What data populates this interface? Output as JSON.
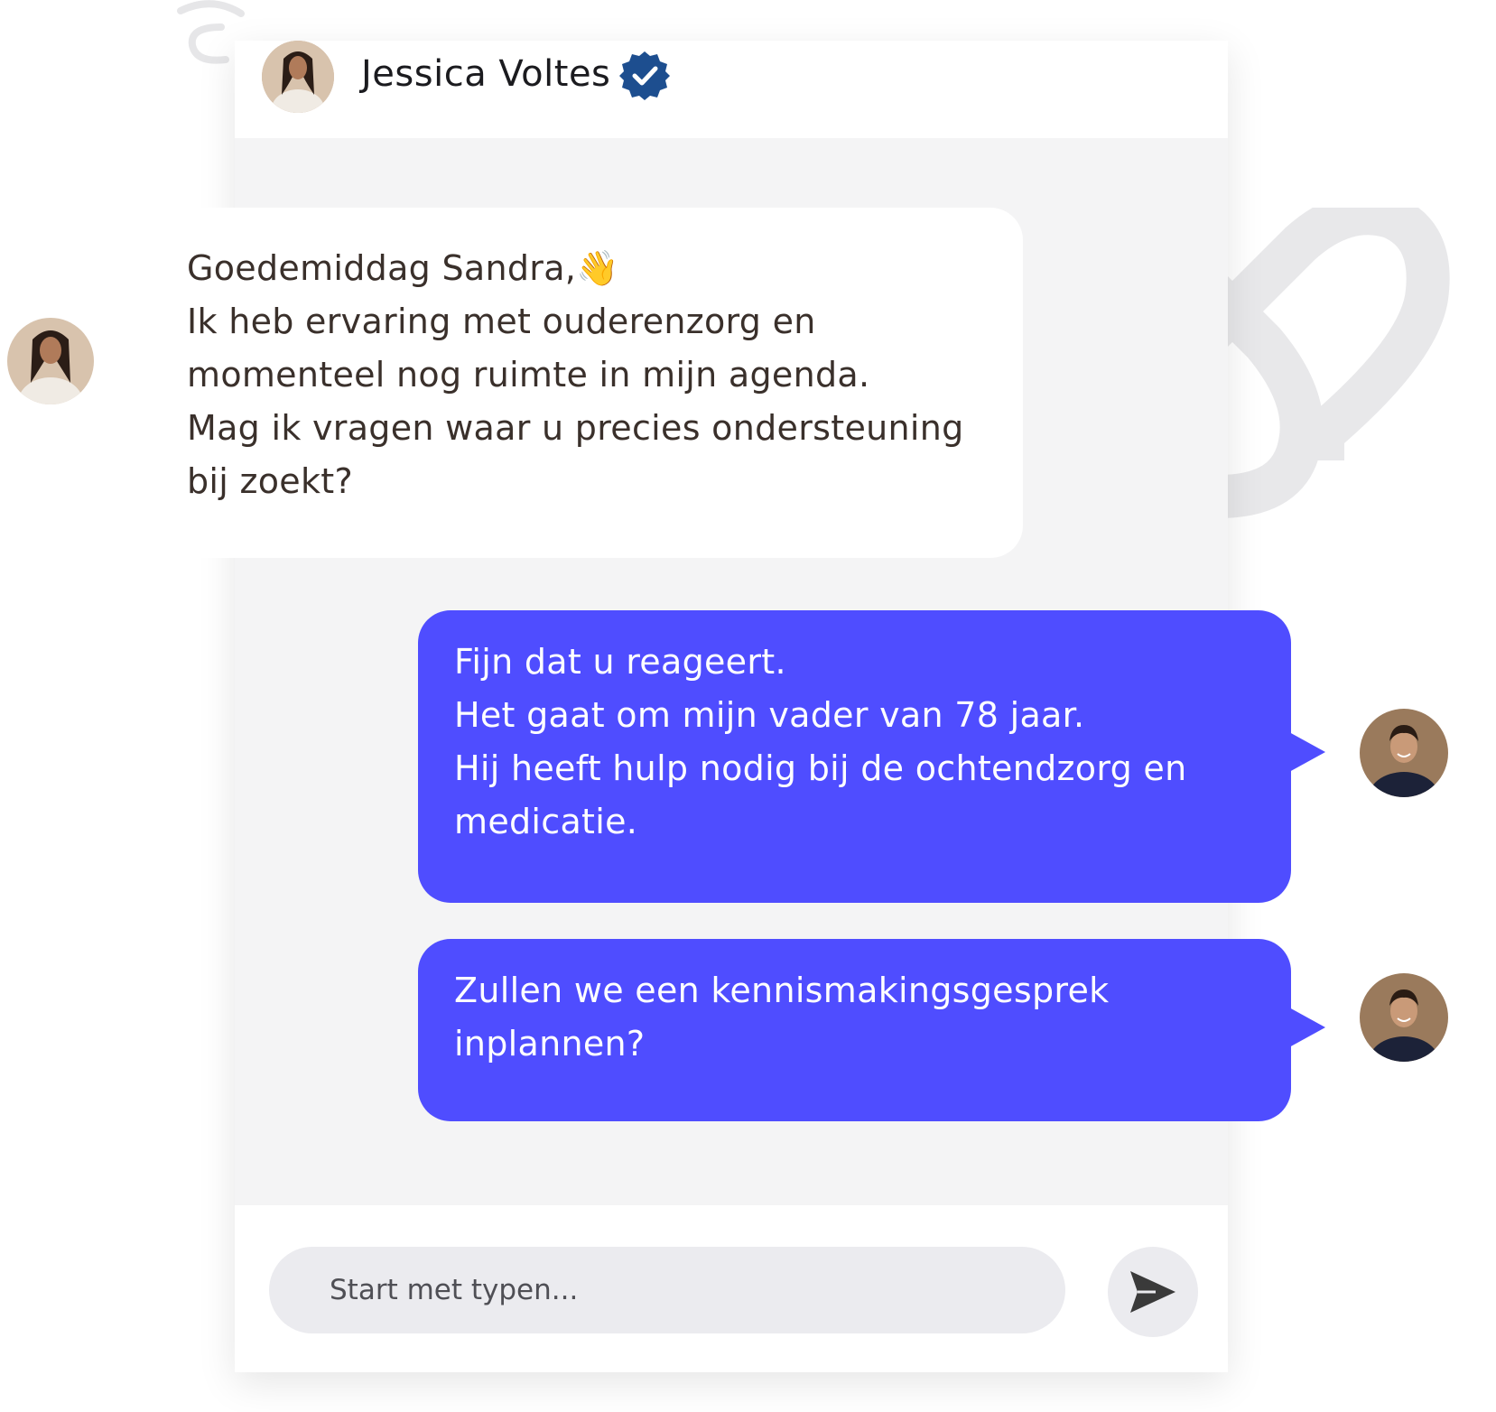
{
  "chat": {
    "contact_name": "Jessica Voltes",
    "icons": {
      "verified": "verified-badge-icon",
      "send": "send-icon"
    },
    "colors": {
      "accent": "#4f4dff",
      "verified": "#1d4e8f",
      "background": "#f4f4f5"
    },
    "messages": [
      {
        "sender": "Jessica Voltes",
        "text": "Goedemiddag Sandra,👋\nIk heb ervaring met ouderenzorg en\nmomenteel nog ruimte in mijn agenda.\nMag ik vragen waar u precies ondersteuning\nbij zoekt?"
      },
      {
        "sender": "Sandra",
        "text": "Fijn dat u reageert.\nHet gaat om mijn vader van 78 jaar.\nHij heeft hulp nodig bij de ochtendzorg en\nmedicatie."
      },
      {
        "sender": "Sandra",
        "text": "Zullen we een kennismakingsgesprek\ninplannen?"
      }
    ],
    "composer": {
      "placeholder": "Start met typen..."
    }
  }
}
